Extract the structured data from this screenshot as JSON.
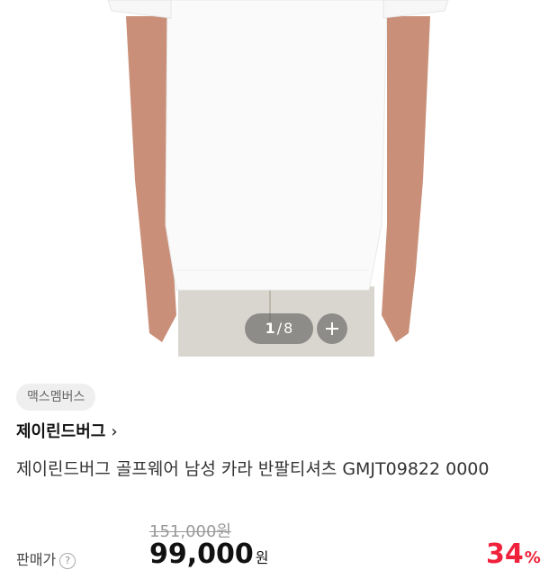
{
  "gallery": {
    "current": "1",
    "separator": "/",
    "total": "8"
  },
  "product": {
    "badge": "맥스멤버스",
    "brand": "제이린드버그",
    "brand_chevron": "›",
    "title": "제이린드버그 골프웨어 남성 카라 반팔티셔츠 GMJT09822 0000",
    "original_price": "151,000원",
    "price_label": "판매가",
    "price_help_icon": "?",
    "price": "99,000",
    "currency": "원",
    "discount": "34",
    "discount_unit": "%"
  },
  "colors": {
    "discount": "#f0213b"
  }
}
